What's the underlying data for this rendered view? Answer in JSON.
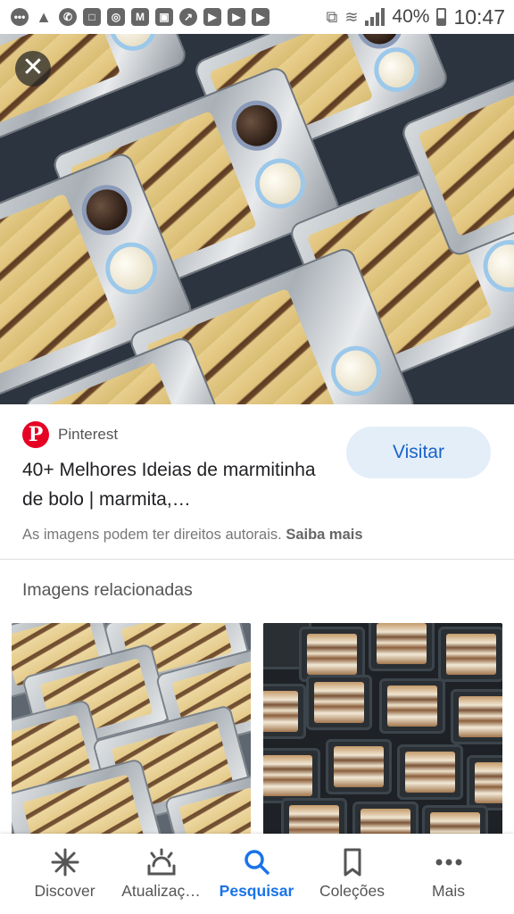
{
  "status_bar": {
    "battery_percent": "40%",
    "time": "10:47",
    "notification_icons": [
      "chat-icon",
      "warning-icon",
      "whatsapp-icon",
      "app-icon",
      "instagram-icon",
      "gmail-icon",
      "app-icon",
      "app-icon",
      "youtube-icon",
      "youtube-icon",
      "youtube-icon"
    ]
  },
  "result": {
    "source_name": "Pinterest",
    "title": "40+ Melhores Ideias de marmitinha de bolo | marmita,…",
    "visit_label": "Visitar",
    "copyright_text": "As imagens podem ter direitos autorais.",
    "copyright_link": "Saiba mais"
  },
  "related": {
    "heading": "Imagens relacionadas"
  },
  "bottom_nav": {
    "items": [
      {
        "label": "Discover",
        "icon": "asterisk-icon",
        "active": false
      },
      {
        "label": "Atualizaç…",
        "icon": "updates-icon",
        "active": false
      },
      {
        "label": "Pesquisar",
        "icon": "search-icon",
        "active": true
      },
      {
        "label": "Coleções",
        "icon": "bookmark-icon",
        "active": false
      },
      {
        "label": "Mais",
        "icon": "more-icon",
        "active": false
      }
    ]
  },
  "colors": {
    "accent": "#1a73e8",
    "visit_button_bg": "#e3eef9",
    "pinterest_red": "#e60023"
  }
}
